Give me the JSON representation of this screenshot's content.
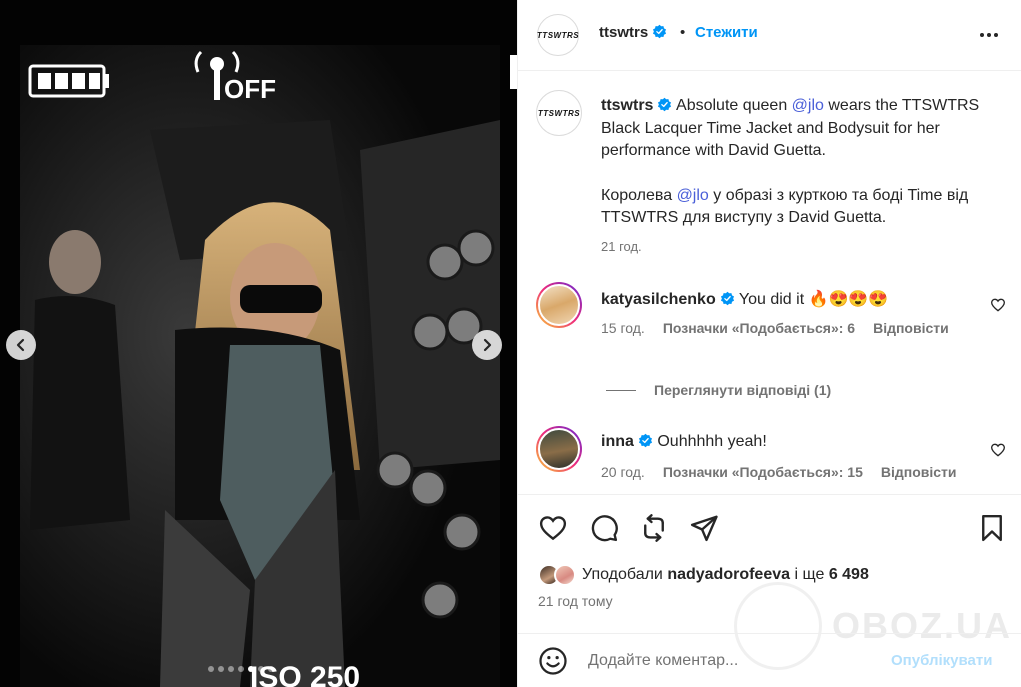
{
  "post": {
    "author": "ttswtrs",
    "separator": "•",
    "follow_label": "Стежити",
    "logo_text": "TTSWTRS"
  },
  "caption": {
    "author": "ttswtrs",
    "text_1": " Absolute queen ",
    "mention_1": "@jlo",
    "text_2": " wears the TTSWTRS Black Lacquer Time Jacket and Bodysuit for her performance with David Guetta.",
    "text_3": "Королева ",
    "mention_2": "@jlo",
    "text_4": " у образі з курткою та боді Time від TTSWTRS для виступу з David Guetta.",
    "time": "21 год."
  },
  "comments": [
    {
      "username": "katyasilchenko",
      "text": "You did it 🔥😍😍😍",
      "time": "15 год.",
      "likes_label": "Позначки «Подобається»: 6",
      "reply_label": "Відповісти"
    },
    {
      "username": "inna",
      "text": "Ouhhhhh yeah!",
      "time": "20 год.",
      "likes_label": "Позначки «Подобається»: 15",
      "reply_label": "Відповісти"
    }
  ],
  "view_replies": "Переглянути відповіді (1)",
  "likes": {
    "prefix": "Уподобали ",
    "user": "nadyadorofeeva",
    "suffix": " і ще ",
    "count": "6 498"
  },
  "posted_ago": "21 год тому",
  "comment_box": {
    "placeholder": "Додайте коментар...",
    "publish_label": "Опублікувати"
  },
  "carousel": {
    "slides": 7,
    "active_slide": 4
  },
  "camera_overlay": {
    "wifi_label": "OFF",
    "iso_label": "ISO 250"
  },
  "watermark": "OBOZ.UA",
  "icons": [
    "verified-icon",
    "more-icon",
    "heart-icon",
    "comment-icon",
    "repost-icon",
    "share-icon",
    "bookmark-icon",
    "emoji-icon",
    "chevron-left-icon",
    "chevron-right-icon"
  ],
  "colors": {
    "accent": "#0095f6",
    "mention": "#4a5fd8",
    "muted": "#737373",
    "publish_disabled": "#b2dffc",
    "verified": "#0095f6"
  }
}
